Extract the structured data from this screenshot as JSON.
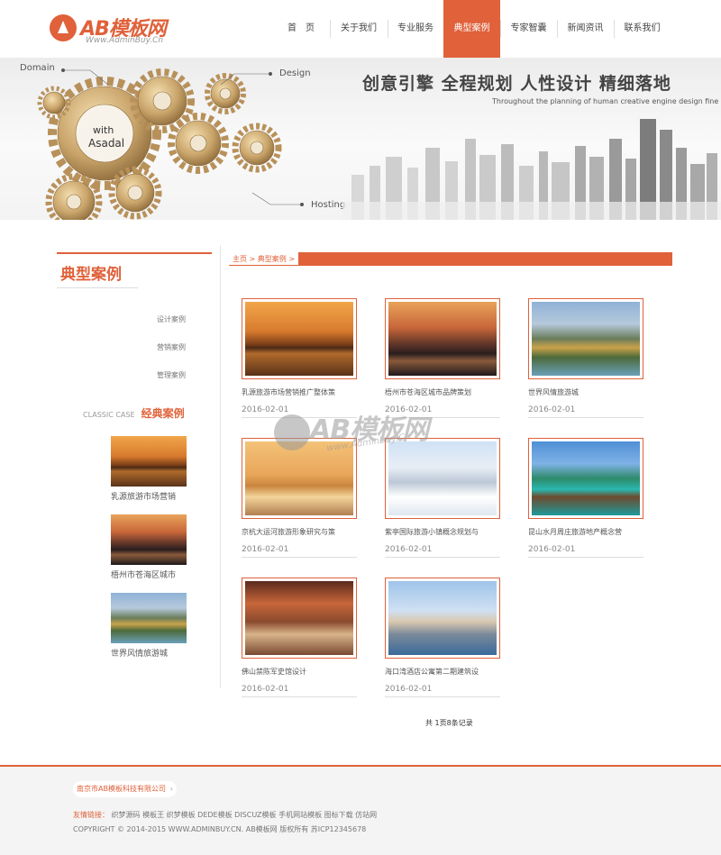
{
  "logo": {
    "text": "AB模板网",
    "sub": "Www.AdminBuy.Cn"
  },
  "nav": [
    {
      "label": "首　页"
    },
    {
      "label": "关于我们"
    },
    {
      "label": "专业服务"
    },
    {
      "label": "典型案例",
      "active": true
    },
    {
      "label": "专家智囊"
    },
    {
      "label": "新闻资讯"
    },
    {
      "label": "联系我们"
    }
  ],
  "banner": {
    "title": "创意引擎  全程规划  人性设计  精细落地",
    "subtitle": "Throughout the planning of human creative engine design fine floor",
    "labels": {
      "domain": "Domain",
      "design": "Design",
      "hosting": "Hosting",
      "center1": "with",
      "center2": "Asadal"
    }
  },
  "sidebar": {
    "title": "典型案例",
    "links": [
      "设计案例",
      "营销案例",
      "管理案例"
    ],
    "classic_en": "CLASSIC CASE",
    "classic_cn": "经典案例",
    "cases": [
      {
        "caption": "乳源旅游市场营销",
        "img": "castle"
      },
      {
        "caption": "梧州市苍海区城市",
        "img": "sunset"
      },
      {
        "caption": "世界风情旅游城",
        "img": "mountain"
      }
    ]
  },
  "breadcrumb": "主页 > 典型案例 >",
  "cases": [
    {
      "title": "乳源旅游市场营销推广整体策",
      "date": "2016-02-01",
      "img": "castle"
    },
    {
      "title": "梧州市苍海区城市品牌策划",
      "date": "2016-02-01",
      "img": "sunset"
    },
    {
      "title": "世界风情旅游城",
      "date": "2016-02-01",
      "img": "mountain"
    },
    {
      "title": "京杭大运河旅游形象研究与策",
      "date": "2016-02-01",
      "img": "gate"
    },
    {
      "title": "紫亭国际旅游小镇概念规划与",
      "date": "2016-02-01",
      "img": "snow"
    },
    {
      "title": "昆山水月周庄旅游地产概念营",
      "date": "2016-02-01",
      "img": "pier"
    },
    {
      "title": "佛山禁陈军史馆设计",
      "date": "2016-02-01",
      "img": "hall"
    },
    {
      "title": "海口湾酒店公寓第二期建筑设",
      "date": "2016-02-01",
      "img": "building"
    }
  ],
  "pager": "共 1页8条记录",
  "watermark": {
    "text": "AB模板网",
    "sub": "www.AdminBuy.Cn"
  },
  "footer": {
    "company": "南京市AB模板科技有限公司",
    "links_label": "友情链接：",
    "links": "织梦源码  模板王  织梦模板  DEDE模板  DISCUZ模板  手机网站模板  图标下载  仿站网",
    "copyright": "COPYRIGHT © 2014-2015 WWW.ADMINBUY.CN. AB模板网 版权所有   苏ICP12345678"
  },
  "colors": {
    "accent": "#e0613a"
  }
}
